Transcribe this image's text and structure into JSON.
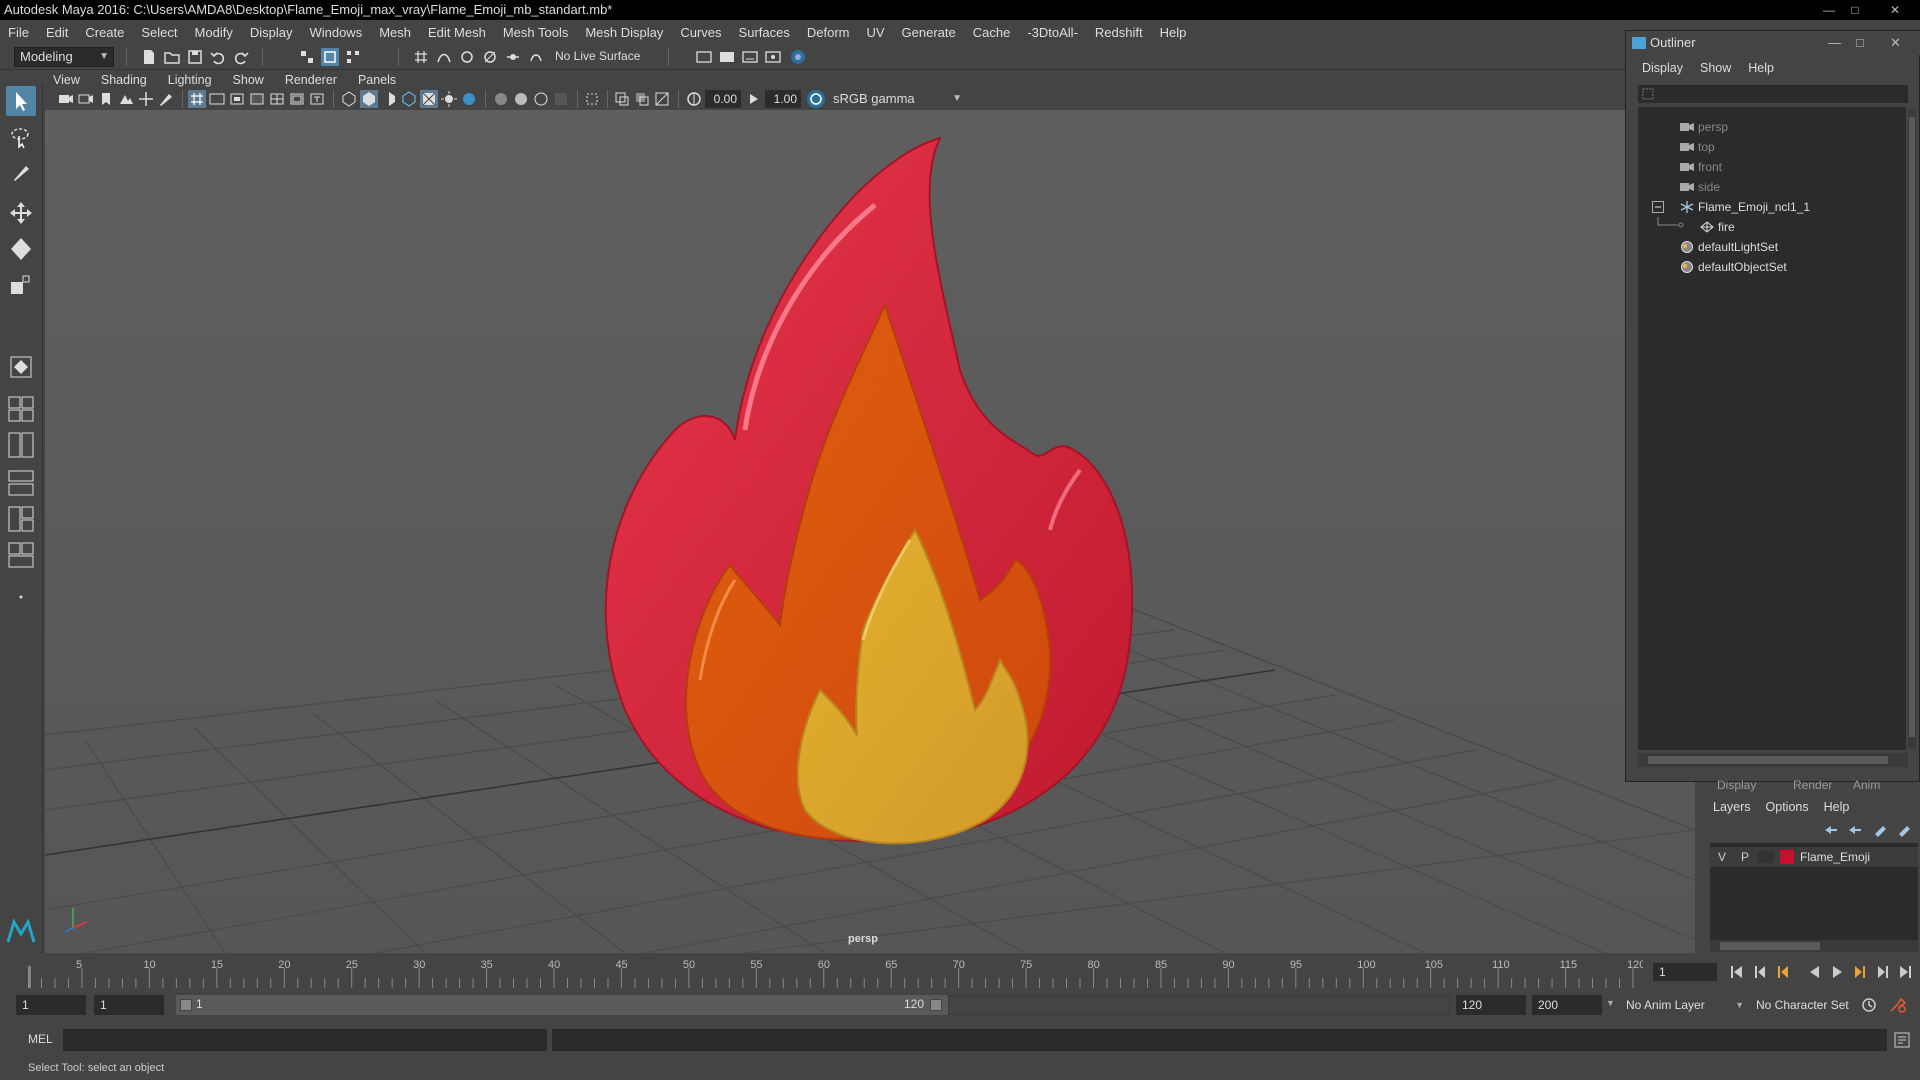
{
  "window": {
    "title": "Autodesk Maya 2016: C:\\Users\\AMDA8\\Desktop\\Flame_Emoji_max_vray\\Flame_Emoji_mb_standart.mb*"
  },
  "menubar": [
    "File",
    "Edit",
    "Create",
    "Select",
    "Modify",
    "Display",
    "Windows",
    "Mesh",
    "Edit Mesh",
    "Mesh Tools",
    "Mesh Display",
    "Curves",
    "Surfaces",
    "Deform",
    "UV",
    "Generate",
    "Cache",
    "-3DtoAll-",
    "Redshift",
    "Help"
  ],
  "shelf": {
    "mode": "Modeling",
    "live_surface": "No Live Surface"
  },
  "viewport": {
    "menu": [
      "View",
      "Shading",
      "Lighting",
      "Show",
      "Renderer",
      "Panels"
    ],
    "exposure": "0.00",
    "gamma": "1.00",
    "color_space": "sRGB gamma",
    "camera_label": "persp"
  },
  "outliner": {
    "title": "Outliner",
    "menu": [
      "Display",
      "Show",
      "Help"
    ],
    "items": [
      {
        "label": "persp"
      },
      {
        "label": "top"
      },
      {
        "label": "front"
      },
      {
        "label": "side"
      },
      {
        "label": "Flame_Emoji_ncl1_1"
      },
      {
        "label": "fire"
      },
      {
        "label": "defaultLightSet"
      },
      {
        "label": "defaultObjectSet"
      }
    ]
  },
  "layers": {
    "tabs": [
      "Display",
      "Render",
      "Anim"
    ],
    "menu": [
      "Layers",
      "Options",
      "Help"
    ],
    "row": {
      "v": "V",
      "p": "P",
      "name": "Flame_Emoji",
      "color": "#c8102e"
    }
  },
  "timeline": {
    "ticks": [
      "1",
      "5",
      "10",
      "15",
      "20",
      "25",
      "30",
      "35",
      "40",
      "45",
      "50",
      "55",
      "60",
      "65",
      "70",
      "75",
      "80",
      "85",
      "90",
      "95",
      "100",
      "105",
      "110",
      "115",
      "120"
    ],
    "current_frame": "1"
  },
  "range": {
    "start": "1",
    "playback_start": "1",
    "slider_start": "1",
    "slider_end": "120",
    "playback_end": "120",
    "end": "200",
    "anim_layer": "No Anim Layer",
    "character_set": "No Character Set"
  },
  "command": {
    "lang": "MEL"
  },
  "help": {
    "text": "Select Tool: select an object"
  },
  "colors": {
    "accent": "#5285a6",
    "flame_outer": "#d42a3c",
    "flame_mid": "#d9530f",
    "flame_inner": "#d6a12c"
  }
}
